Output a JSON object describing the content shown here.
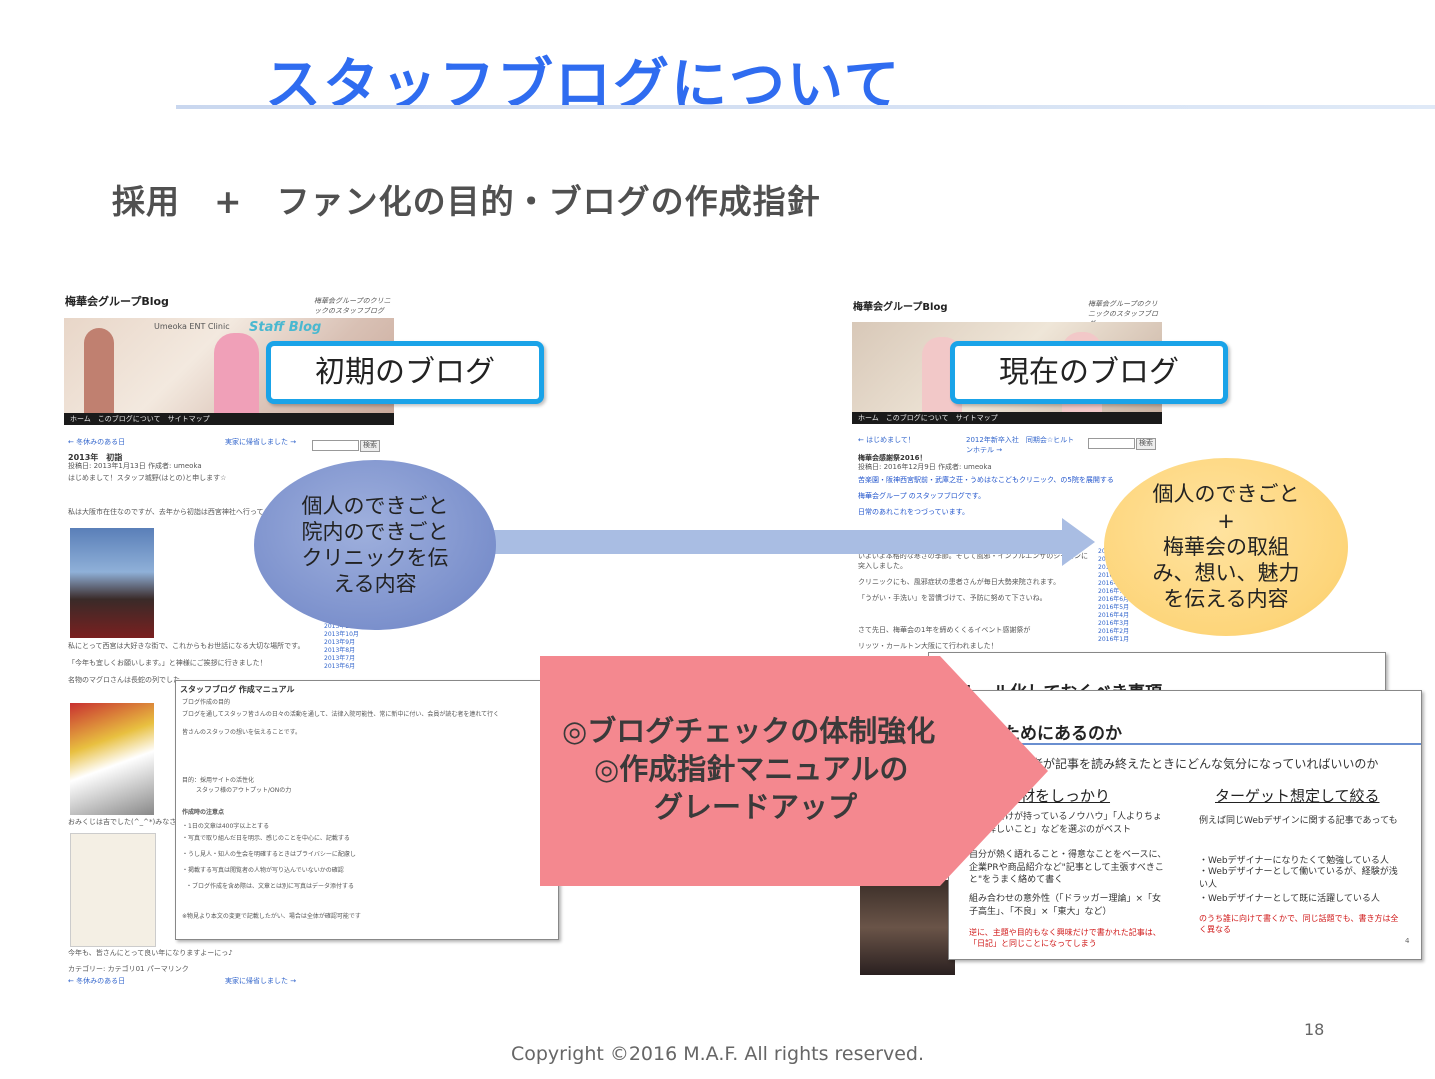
{
  "slide": {
    "title": "スタッフブログについて",
    "subtitle": "採用　+　ファン化の目的・ブログの作成指針",
    "page_number": "18",
    "copyright": "Copyright ©2016 M.A.F.  All rights reserved."
  },
  "left_screenshot": {
    "blog_title": "梅華会グループBlog",
    "tagline": "梅華会グループのクリニックのスタッフブログ",
    "header_text": "Umeoka ENT Clinic",
    "header_logo": "Staff Blog",
    "nav": "ホーム　このブログについて　サイトマップ",
    "prev_link": "← 冬休みのある日",
    "next_link": "実家に帰省しました →",
    "search_button": "検索",
    "post_title": "2013年　初詣",
    "post_meta": "投稿日: 2013年1月13日 作成者: umeoka",
    "lines": [
      "はじめまして！スタッフ城野(はとの)と申します☆",
      "私は大阪市在住なのですが、去年から初詣は西宮神社へ行って",
      "私にとって西宮は大好きな街で、これからもお世話になる大切な場所です。",
      "「今年も宜しくお願いします。」と神様にご挨拶に行きました！",
      "名物のマグロさんは長蛇の列でした",
      "おみくじは吉でした(^_^*)みなさん",
      "今年も、皆さんにとって良い年になりますよーにっ♪",
      "カテゴリー: カテゴリ01 パーマリンク"
    ],
    "bottom_prev": "← 冬休みのある日",
    "bottom_next": "実家に帰省しました →",
    "callout": "初期のブログ",
    "ellipse": "個人のできごと院内のできごと\nクリニックを伝える内容",
    "manual": {
      "title": "スタッフブログ 作成マニュアル",
      "lines": [
        "ブログ作成の目的",
        "ブログを通してスタッフ皆さんの日々の活動を通して、法律入院可能性、常に新中に付い、会員が読む者を連れて行く",
        "皆さんのスタッフの想いを伝えることです。",
        "目的：採用サイトの活性化",
        "スタッフ様のアウトプット/ONの力",
        "作成時の注意点",
        "・1日の文章は400字以上とする",
        "・写真で取り組んだ日を明示、感じのことを中心に、記載する",
        "・うし見人・知人の生会を明確するときはプライバシーに配慮し",
        "・掲載する写真は閲覧者の人物が写り込んでいないかの確認",
        "・ブログ作成を含め際は、文章とは別に写真はデータ添付する",
        "※物見より本文の変更で記載したがい、場合は全体が確認可能です"
      ]
    }
  },
  "right_screenshot": {
    "blog_title": "梅華会グループBlog",
    "tagline": "梅華会グループのクリニックのスタッフブログ",
    "nav": "ホーム　このブログについて　サイトマップ",
    "prev_link": "← はじめまして！",
    "mid_link": "2012年新卒入社　同期会☆ヒルトンホテル →",
    "search_button": "検索",
    "post_title": "梅華会感謝祭2016！",
    "post_meta": "投稿日: 2016年12月9日 作成者: umeoka",
    "lines": [
      "苦楽園・阪神西宮駅前・武庫之荘・うめはなこどもクリニック、の5院を展開する",
      "梅華会グループ のスタッフブログです。",
      "日常のあれこれをつづっています。",
      "いよいよ本格的な寒さの季節。そして風邪・インフルエンザのシーズンに突入しました。",
      "クリニックにも、風邪症状の患者さんが毎日大勢来院されます。",
      "「うがい・手洗い」を習慣づけて、予防に努めて下さいね。",
      "さて先日、梅華会の1年を締めくくるイベント感謝祭が",
      "リッツ・カールトン大阪にて行われました！"
    ],
    "callout": "現在のブログ",
    "ellipse": "個人のできごと\n+\n梅華会の取組み、想い、魅力を伝える内容",
    "doc_back_heading": "ルール化しておくべき事項",
    "doc_front": {
      "heading": "誰のためにあるのか",
      "question": "読者が記事を読み終えたときにどんな気分になっていればいいのか",
      "left_heading": "取材をしっかり",
      "left_lines": [
        "・自分だけが持っているノウハウ」「人よりちょっと詳しいこと」などを選ぶのがベスト",
        "自分が熱く語れること・得意なことをベースに、企業PRや商品紹介など\"記事として主張すべきこと\"をうまく絡めて書く",
        "組み合わせの意外性（「ドラッガー理論」×「女子高生」、「不良」×「東大」など）"
      ],
      "left_warning": "逆に、主題や目的もなく興味だけで書かれた記事は、「日記」と同じことになってしまう",
      "right_heading": "ターゲット想定して絞る",
      "right_lines": [
        "例えば同じWebデザインに関する記事であっても",
        "・Webデザイナーになりたくて勉強している人",
        "・Webデザイナーとして働いているが、経験が浅い人",
        "・Webデザイナーとして既に活躍している人"
      ],
      "right_warning": "のうち誰に向けて書くかで、同じ話題でも、書き方は全く異なる",
      "page_no": "4"
    }
  },
  "arrow_banner": {
    "lines": [
      "◎ブログチェックの体制強化",
      "◎作成指針マニュアルの",
      "グレードアップ"
    ],
    "color": "#f4888f"
  },
  "colors": {
    "title": "#2f6cf0",
    "callout_border": "#1aa3e8",
    "ellipse_left": "#7b90cc",
    "ellipse_right": "#fdd57a",
    "flow_arrow": "#a9bde3"
  }
}
